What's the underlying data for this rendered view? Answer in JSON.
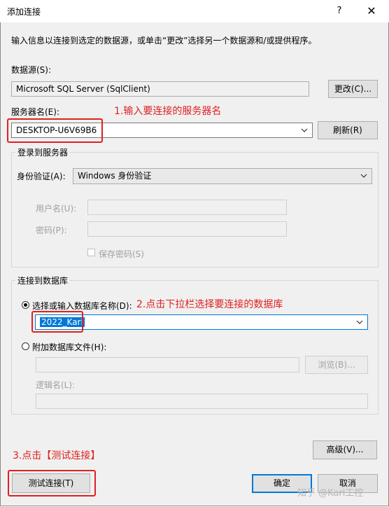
{
  "window": {
    "title": "添加连接",
    "help": "?",
    "close": "✕"
  },
  "intro": "输入信息以连接到选定的数据源，或单击“更改”选择另一个数据源和/或提供程序。",
  "datasource": {
    "label": "数据源(S):",
    "value": "Microsoft SQL Server (SqlClient)",
    "change_button": "更改(C)..."
  },
  "server": {
    "label": "服务器名(E):",
    "value": "DESKTOP-U6V69B6",
    "refresh_button": "刷新(R)"
  },
  "login": {
    "group_title": "登录到服务器",
    "auth_label": "身份验证(A):",
    "auth_value": "Windows 身份验证",
    "username_label": "用户名(U):",
    "password_label": "密码(P):",
    "save_password_label": "保存密码(S)"
  },
  "connect_db": {
    "group_title": "连接到数据库",
    "select_radio_label": "选择或输入数据库名称(D):",
    "db_value": "2022_Karl",
    "attach_radio_label": "附加数据库文件(H):",
    "browse_button": "浏览(B)...",
    "logical_name_label": "逻辑名(L):"
  },
  "advanced_button": "高级(V)...",
  "test_button": "测试连接(T)",
  "ok_button": "确定",
  "cancel_button": "取消",
  "annotations": {
    "step1": "1.输入要连接的服务器名",
    "step2": "2.点击下拉栏选择要连接的数据库",
    "step3": "3.点击【测试连接】"
  },
  "watermark": "知乎 @Karl工控",
  "colors": {
    "annotation_red": "#e02020",
    "selection_blue": "#0078d7",
    "dialog_bg": "#f0f0f0"
  },
  "icons": {
    "dropdown": "chevron-down-icon",
    "radio_selected": "radio-selected-icon",
    "radio_unselected": "radio-unselected-icon"
  }
}
